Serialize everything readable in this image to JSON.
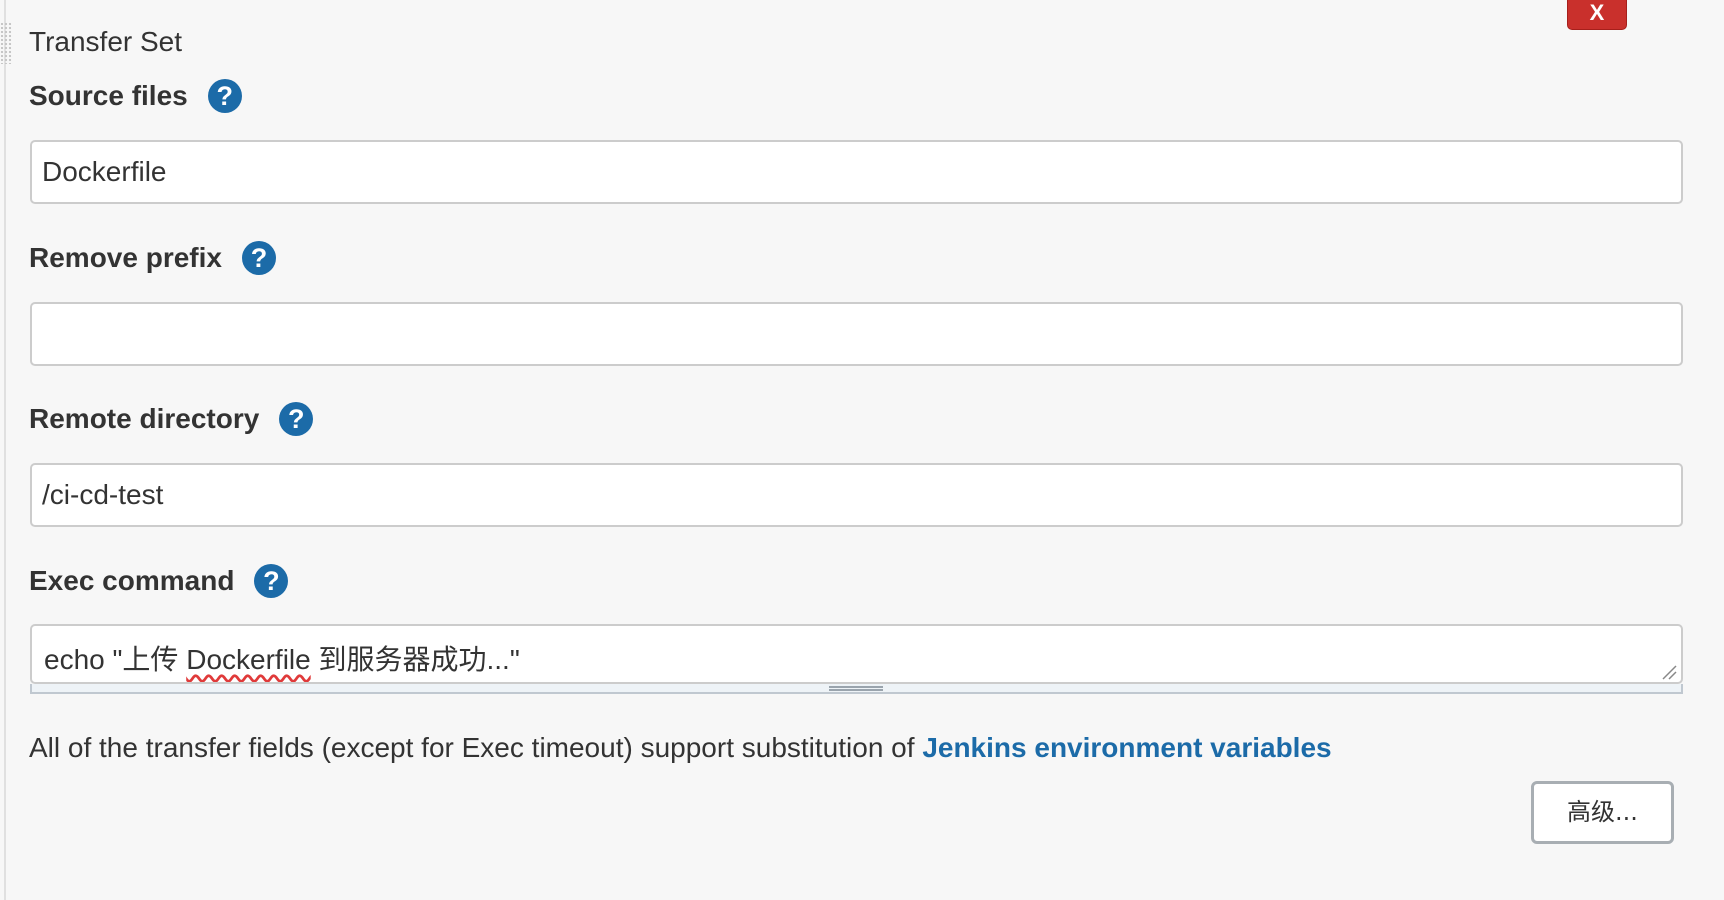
{
  "transfer_set": {
    "title": "Transfer Set",
    "delete_label": "X",
    "help_glyph": "?",
    "fields": {
      "source_files": {
        "label": "Source files",
        "value": "Dockerfile"
      },
      "remove_prefix": {
        "label": "Remove prefix",
        "value": ""
      },
      "remote_directory": {
        "label": "Remote directory",
        "value": "/ci-cd-test"
      },
      "exec_command": {
        "label": "Exec command",
        "value_prefix": "echo \"上传 ",
        "value_misspelled": "Dockerfile",
        "value_suffix": " 到服务器成功...\""
      }
    },
    "info": {
      "text": "All of the transfer fields (except for Exec timeout) support substitution of ",
      "link_text": "Jenkins environment variables"
    },
    "advanced_button": "高级..."
  },
  "icons": {
    "help": "help-icon",
    "delete": "close-icon",
    "drag": "drag-handle-icon",
    "resize": "resize-grip-icon"
  },
  "colors": {
    "help_icon": "#1c6ba8",
    "delete_button": "#c9302c",
    "link": "#1c6ba8",
    "panel_background": "#f7f7f7"
  }
}
